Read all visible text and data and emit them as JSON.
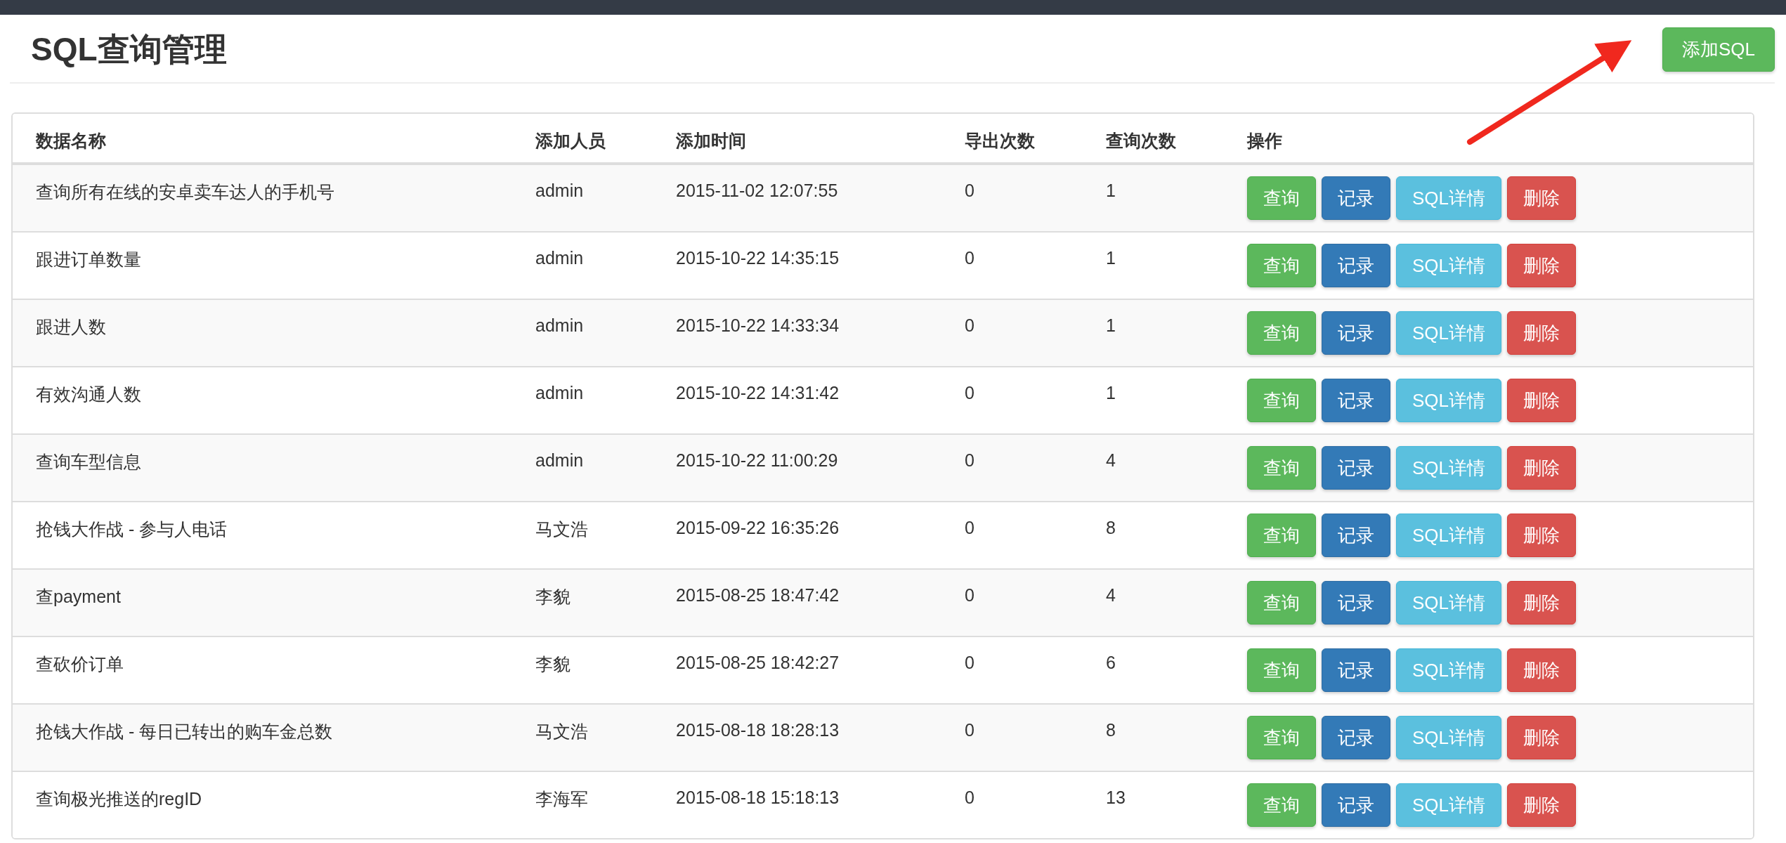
{
  "page": {
    "title": "SQL查询管理",
    "add_button": "添加SQL"
  },
  "table": {
    "columns": [
      "数据名称",
      "添加人员",
      "添加时间",
      "导出次数",
      "查询次数",
      "操作"
    ],
    "rows": [
      {
        "name": "查询所有在线的安卓卖车达人的手机号",
        "user": "admin",
        "time": "2015-11-02 12:07:55",
        "exports": "0",
        "queries": "1",
        "actions": [
          {
            "label": "查询",
            "kind": "success"
          },
          {
            "label": "记录",
            "kind": "primary"
          },
          {
            "label": "SQL详情",
            "kind": "info"
          },
          {
            "label": "删除",
            "kind": "danger"
          }
        ]
      },
      {
        "name": "跟进订单数量",
        "user": "admin",
        "time": "2015-10-22 14:35:15",
        "exports": "0",
        "queries": "1",
        "actions": [
          {
            "label": "查询",
            "kind": "success"
          },
          {
            "label": "记录",
            "kind": "primary"
          },
          {
            "label": "SQL详情",
            "kind": "info"
          },
          {
            "label": "删除",
            "kind": "danger"
          }
        ]
      },
      {
        "name": "跟进人数",
        "user": "admin",
        "time": "2015-10-22 14:33:34",
        "exports": "0",
        "queries": "1",
        "actions": [
          {
            "label": "查询",
            "kind": "success"
          },
          {
            "label": "记录",
            "kind": "primary"
          },
          {
            "label": "SQL详情",
            "kind": "info"
          },
          {
            "label": "删除",
            "kind": "danger"
          }
        ]
      },
      {
        "name": "有效沟通人数",
        "user": "admin",
        "time": "2015-10-22 14:31:42",
        "exports": "0",
        "queries": "1",
        "actions": [
          {
            "label": "查询",
            "kind": "success"
          },
          {
            "label": "记录",
            "kind": "primary"
          },
          {
            "label": "SQL详情",
            "kind": "info"
          },
          {
            "label": "删除",
            "kind": "danger"
          }
        ]
      },
      {
        "name": "查询车型信息",
        "user": "admin",
        "time": "2015-10-22 11:00:29",
        "exports": "0",
        "queries": "4",
        "actions": [
          {
            "label": "查询",
            "kind": "success"
          },
          {
            "label": "记录",
            "kind": "primary"
          },
          {
            "label": "SQL详情",
            "kind": "info"
          },
          {
            "label": "删除",
            "kind": "danger"
          }
        ]
      },
      {
        "name": "抢钱大作战 - 参与人电话",
        "user": "马文浩",
        "time": "2015-09-22 16:35:26",
        "exports": "0",
        "queries": "8",
        "actions": [
          {
            "label": "查询",
            "kind": "success"
          },
          {
            "label": "记录",
            "kind": "primary"
          },
          {
            "label": "SQL详情",
            "kind": "info"
          },
          {
            "label": "删除",
            "kind": "danger"
          }
        ]
      },
      {
        "name": "查payment",
        "user": "李貌",
        "time": "2015-08-25 18:47:42",
        "exports": "0",
        "queries": "4",
        "actions": [
          {
            "label": "查询",
            "kind": "success"
          },
          {
            "label": "记录",
            "kind": "primary"
          },
          {
            "label": "SQL详情",
            "kind": "info"
          },
          {
            "label": "删除",
            "kind": "danger"
          }
        ]
      },
      {
        "name": "查砍价订单",
        "user": "李貌",
        "time": "2015-08-25 18:42:27",
        "exports": "0",
        "queries": "6",
        "actions": [
          {
            "label": "查询",
            "kind": "success"
          },
          {
            "label": "记录",
            "kind": "primary"
          },
          {
            "label": "SQL详情",
            "kind": "info"
          },
          {
            "label": "删除",
            "kind": "danger"
          }
        ]
      },
      {
        "name": "抢钱大作战 - 每日已转出的购车金总数",
        "user": "马文浩",
        "time": "2015-08-18 18:28:13",
        "exports": "0",
        "queries": "8",
        "actions": [
          {
            "label": "查询",
            "kind": "success"
          },
          {
            "label": "记录",
            "kind": "primary"
          },
          {
            "label": "SQL详情",
            "kind": "info"
          },
          {
            "label": "删除",
            "kind": "danger"
          }
        ]
      },
      {
        "name": "查询极光推送的regID",
        "user": "李海军",
        "time": "2015-08-18 15:18:13",
        "exports": "0",
        "queries": "13",
        "actions": [
          {
            "label": "查询",
            "kind": "success"
          },
          {
            "label": "记录",
            "kind": "primary"
          },
          {
            "label": "SQL详情",
            "kind": "info"
          },
          {
            "label": "删除",
            "kind": "danger"
          }
        ]
      }
    ]
  }
}
